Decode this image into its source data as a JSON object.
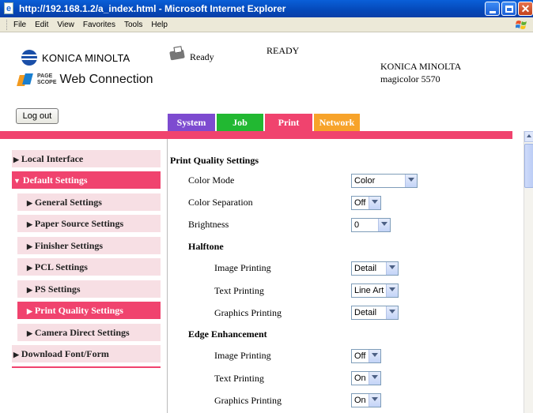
{
  "window": {
    "title": "http://192.168.1.2/a_index.html - Microsoft Internet Explorer"
  },
  "menu": [
    "File",
    "Edit",
    "View",
    "Favorites",
    "Tools",
    "Help"
  ],
  "header": {
    "brand": "KONICA MINOLTA",
    "pagescope_small": [
      "PAGE",
      "SCOPE"
    ],
    "product": "Web Connection",
    "ready_label": "Ready",
    "status": "READY",
    "model_line1": "KONICA MINOLTA",
    "model_line2": "magicolor 5570",
    "logout_label": "Log out"
  },
  "tabs": [
    {
      "label": "System",
      "color": "#7d4bd0"
    },
    {
      "label": "Job",
      "color": "#22b832"
    },
    {
      "label": "Print",
      "color": "#f0436e"
    },
    {
      "label": "Network",
      "color": "#f7a32a"
    }
  ],
  "accent_color": "#f0436e",
  "nav": [
    {
      "label": "Local Interface",
      "expanded": false,
      "active": false
    },
    {
      "label": "Default Settings",
      "expanded": true,
      "active": true
    },
    {
      "label": "General Settings",
      "active": false
    },
    {
      "label": "Paper Source Settings",
      "active": false
    },
    {
      "label": "Finisher Settings",
      "active": false
    },
    {
      "label": "PCL Settings",
      "active": false
    },
    {
      "label": "PS Settings",
      "active": false
    },
    {
      "label": "Print Quality Settings",
      "active": true
    },
    {
      "label": "Camera Direct Settings",
      "active": false
    },
    {
      "label": "Download Font/Form",
      "active": false
    }
  ],
  "content": {
    "heading": "Print Quality Settings",
    "color_mode": {
      "label": "Color Mode",
      "value": "Color"
    },
    "color_separation": {
      "label": "Color Separation",
      "value": "Off"
    },
    "brightness": {
      "label": "Brightness",
      "value": "0"
    },
    "halftone": {
      "heading": "Halftone",
      "image": {
        "label": "Image Printing",
        "value": "Detail"
      },
      "text": {
        "label": "Text Printing",
        "value": "Line Art"
      },
      "graphics": {
        "label": "Graphics Printing",
        "value": "Detail"
      }
    },
    "edge": {
      "heading": "Edge Enhancement",
      "image": {
        "label": "Image Printing",
        "value": "Off"
      },
      "text": {
        "label": "Text Printing",
        "value": "On"
      },
      "graphics": {
        "label": "Graphics Printing",
        "value": "On"
      }
    }
  }
}
